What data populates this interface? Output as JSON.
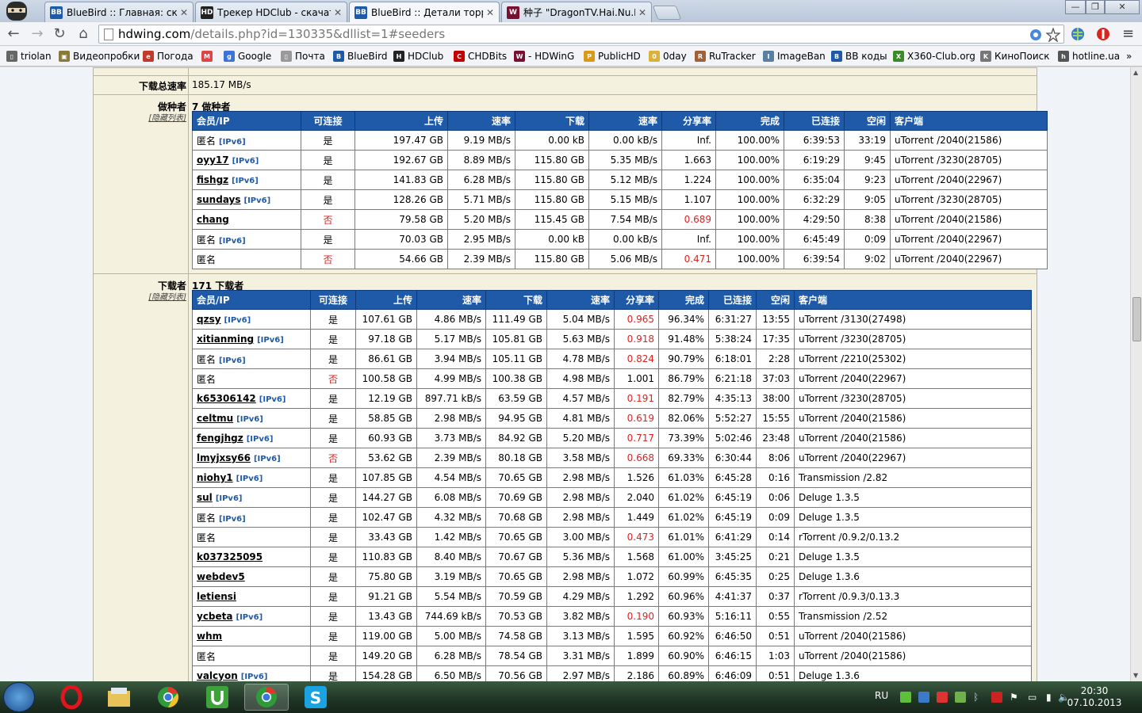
{
  "browser": {
    "tabs": [
      {
        "title": "BlueBird :: Главная: скача",
        "active": false,
        "fav": "BB",
        "color": "#1e5aa8"
      },
      {
        "title": "Трекер HDClub - скачать",
        "active": false,
        "fav": "HD",
        "color": "#222222"
      },
      {
        "title": "BlueBird :: Детали торрен",
        "active": true,
        "fav": "BB",
        "color": "#1e5aa8"
      },
      {
        "title": "种子 \"DragonTV.Hai.Nu.E(",
        "active": false,
        "fav": "W",
        "color": "#7a1030"
      }
    ],
    "url_host": "hdwing.com",
    "url_path": "/details.php?id=130335&dllist=1#seeders",
    "bookmarks": [
      {
        "label": "triolan",
        "color": "#666666",
        "glyph": "▯"
      },
      {
        "label": "Видеопробки",
        "color": "#8a7a3a",
        "glyph": "▣"
      },
      {
        "label": "Погода",
        "color": "#c0392b",
        "glyph": "e"
      },
      {
        "label": "",
        "color": "#d44",
        "glyph": "M"
      },
      {
        "label": "Google",
        "color": "#3b73d9",
        "glyph": "g"
      },
      {
        "label": "Почта",
        "color": "#999999",
        "glyph": "▯"
      },
      {
        "label": "BlueBird",
        "color": "#1e5aa8",
        "glyph": "B"
      },
      {
        "label": "HDClub",
        "color": "#222222",
        "glyph": "H"
      },
      {
        "label": "CHDBits",
        "color": "#c00000",
        "glyph": "C"
      },
      {
        "label": "- HDWinG",
        "color": "#7a1030",
        "glyph": "W"
      },
      {
        "label": "PublicHD",
        "color": "#d99a1a",
        "glyph": "P"
      },
      {
        "label": "0day",
        "color": "#d8b23a",
        "glyph": "0"
      },
      {
        "label": "RuTracker",
        "color": "#a0603a",
        "glyph": "R"
      },
      {
        "label": "ImageBan",
        "color": "#5a7fa0",
        "glyph": "I"
      },
      {
        "label": "BB коды",
        "color": "#1e5aa8",
        "glyph": "B"
      },
      {
        "label": "X360-Club.org",
        "color": "#3a8a2a",
        "glyph": "X"
      },
      {
        "label": "КиноПоиск",
        "color": "#777777",
        "glyph": "K"
      },
      {
        "label": "hotline.ua",
        "color": "#555555",
        "glyph": "h"
      }
    ],
    "more": "»"
  },
  "page": {
    "speed_label": "下载总速率",
    "speed_value": "185.17 MB/s",
    "seeders": {
      "label": "做种者",
      "toggle": "[隐藏列表]",
      "title": "7 做种者",
      "headers": [
        "会员/IP",
        "可连接",
        "上传",
        "速率",
        "下载",
        "速率",
        "分享率",
        "完成",
        "已连接",
        "空闲",
        "客户端"
      ],
      "rows": [
        {
          "user": "匿名",
          "linked": false,
          "ipv6": true,
          "conn": "是",
          "conn_red": false,
          "up": "197.47 GB",
          "up_rate": "9.19 MB/s",
          "down": "0.00 kB",
          "down_rate": "0.00 kB/s",
          "ratio": "Inf.",
          "ratio_red": false,
          "done": "100.00%",
          "connected": "6:39:53",
          "idle": "33:19",
          "client": "uTorrent /2040(21586)"
        },
        {
          "user": "oyy17",
          "linked": true,
          "ipv6": true,
          "conn": "是",
          "conn_red": false,
          "up": "192.67 GB",
          "up_rate": "8.89 MB/s",
          "down": "115.80 GB",
          "down_rate": "5.35 MB/s",
          "ratio": "1.663",
          "ratio_red": false,
          "done": "100.00%",
          "connected": "6:19:29",
          "idle": "9:45",
          "client": "uTorrent /3230(28705)"
        },
        {
          "user": "fishgz",
          "linked": true,
          "ipv6": true,
          "conn": "是",
          "conn_red": false,
          "up": "141.83 GB",
          "up_rate": "6.28 MB/s",
          "down": "115.80 GB",
          "down_rate": "5.12 MB/s",
          "ratio": "1.224",
          "ratio_red": false,
          "done": "100.00%",
          "connected": "6:35:04",
          "idle": "9:23",
          "client": "uTorrent /2040(22967)"
        },
        {
          "user": "sundays",
          "linked": true,
          "ipv6": true,
          "conn": "是",
          "conn_red": false,
          "up": "128.26 GB",
          "up_rate": "5.71 MB/s",
          "down": "115.80 GB",
          "down_rate": "5.15 MB/s",
          "ratio": "1.107",
          "ratio_red": false,
          "done": "100.00%",
          "connected": "6:32:29",
          "idle": "9:05",
          "client": "uTorrent /3230(28705)"
        },
        {
          "user": "chang",
          "linked": true,
          "ipv6": false,
          "conn": "否",
          "conn_red": true,
          "up": "79.58 GB",
          "up_rate": "5.20 MB/s",
          "down": "115.45 GB",
          "down_rate": "7.54 MB/s",
          "ratio": "0.689",
          "ratio_red": true,
          "done": "100.00%",
          "connected": "4:29:50",
          "idle": "8:38",
          "client": "uTorrent /2040(21586)"
        },
        {
          "user": "匿名",
          "linked": false,
          "ipv6": true,
          "conn": "是",
          "conn_red": false,
          "up": "70.03 GB",
          "up_rate": "2.95 MB/s",
          "down": "0.00 kB",
          "down_rate": "0.00 kB/s",
          "ratio": "Inf.",
          "ratio_red": false,
          "done": "100.00%",
          "connected": "6:45:49",
          "idle": "0:09",
          "client": "uTorrent /2040(22967)"
        },
        {
          "user": "匿名",
          "linked": false,
          "ipv6": false,
          "conn": "否",
          "conn_red": true,
          "up": "54.66 GB",
          "up_rate": "2.39 MB/s",
          "down": "115.80 GB",
          "down_rate": "5.06 MB/s",
          "ratio": "0.471",
          "ratio_red": true,
          "done": "100.00%",
          "connected": "6:39:54",
          "idle": "9:02",
          "client": "uTorrent /2040(22967)"
        }
      ]
    },
    "leechers": {
      "label": "下载者",
      "toggle": "[隐藏列表]",
      "title": "171 下载者",
      "headers": [
        "会员/IP",
        "可连接",
        "上传",
        "速率",
        "下载",
        "速率",
        "分享率",
        "完成",
        "已连接",
        "空闲",
        "客户端"
      ],
      "rows": [
        {
          "user": "qzsy",
          "linked": true,
          "ipv6": true,
          "conn": "是",
          "conn_red": false,
          "up": "107.61 GB",
          "up_rate": "4.86 MB/s",
          "down": "111.49 GB",
          "down_rate": "5.04 MB/s",
          "ratio": "0.965",
          "ratio_red": true,
          "done": "96.34%",
          "connected": "6:31:27",
          "idle": "13:55",
          "client": "uTorrent /3130(27498)"
        },
        {
          "user": "xitianming",
          "linked": true,
          "ipv6": true,
          "conn": "是",
          "conn_red": false,
          "up": "97.18 GB",
          "up_rate": "5.17 MB/s",
          "down": "105.81 GB",
          "down_rate": "5.63 MB/s",
          "ratio": "0.918",
          "ratio_red": true,
          "done": "91.48%",
          "connected": "5:38:24",
          "idle": "17:35",
          "client": "uTorrent /3230(28705)"
        },
        {
          "user": "匿名",
          "linked": false,
          "ipv6": true,
          "conn": "是",
          "conn_red": false,
          "up": "86.61 GB",
          "up_rate": "3.94 MB/s",
          "down": "105.11 GB",
          "down_rate": "4.78 MB/s",
          "ratio": "0.824",
          "ratio_red": true,
          "done": "90.79%",
          "connected": "6:18:01",
          "idle": "2:28",
          "client": "uTorrent /2210(25302)"
        },
        {
          "user": "匿名",
          "linked": false,
          "ipv6": false,
          "conn": "否",
          "conn_red": true,
          "up": "100.58 GB",
          "up_rate": "4.99 MB/s",
          "down": "100.38 GB",
          "down_rate": "4.98 MB/s",
          "ratio": "1.001",
          "ratio_red": false,
          "done": "86.79%",
          "connected": "6:21:18",
          "idle": "37:03",
          "client": "uTorrent /2040(22967)"
        },
        {
          "user": "k65306142",
          "linked": true,
          "ipv6": true,
          "conn": "是",
          "conn_red": false,
          "up": "12.19 GB",
          "up_rate": "897.71 kB/s",
          "down": "63.59 GB",
          "down_rate": "4.57 MB/s",
          "ratio": "0.191",
          "ratio_red": true,
          "done": "82.79%",
          "connected": "4:35:13",
          "idle": "38:00",
          "client": "uTorrent /3230(28705)"
        },
        {
          "user": "celtmu",
          "linked": true,
          "ipv6": true,
          "conn": "是",
          "conn_red": false,
          "up": "58.85 GB",
          "up_rate": "2.98 MB/s",
          "down": "94.95 GB",
          "down_rate": "4.81 MB/s",
          "ratio": "0.619",
          "ratio_red": true,
          "done": "82.06%",
          "connected": "5:52:27",
          "idle": "15:55",
          "client": "uTorrent /2040(21586)"
        },
        {
          "user": "fengjhgz",
          "linked": true,
          "ipv6": true,
          "conn": "是",
          "conn_red": false,
          "up": "60.93 GB",
          "up_rate": "3.73 MB/s",
          "down": "84.92 GB",
          "down_rate": "5.20 MB/s",
          "ratio": "0.717",
          "ratio_red": true,
          "done": "73.39%",
          "connected": "5:02:46",
          "idle": "23:48",
          "client": "uTorrent /2040(21586)"
        },
        {
          "user": "lmyjxsy66",
          "linked": true,
          "ipv6": true,
          "conn": "否",
          "conn_red": true,
          "up": "53.62 GB",
          "up_rate": "2.39 MB/s",
          "down": "80.18 GB",
          "down_rate": "3.58 MB/s",
          "ratio": "0.668",
          "ratio_red": true,
          "done": "69.33%",
          "connected": "6:30:44",
          "idle": "8:06",
          "client": "uTorrent /2040(22967)"
        },
        {
          "user": "niohy1",
          "linked": true,
          "ipv6": true,
          "conn": "是",
          "conn_red": false,
          "up": "107.85 GB",
          "up_rate": "4.54 MB/s",
          "down": "70.65 GB",
          "down_rate": "2.98 MB/s",
          "ratio": "1.526",
          "ratio_red": false,
          "done": "61.03%",
          "connected": "6:45:28",
          "idle": "0:16",
          "client": "Transmission /2.82"
        },
        {
          "user": "sul",
          "linked": true,
          "ipv6": true,
          "conn": "是",
          "conn_red": false,
          "up": "144.27 GB",
          "up_rate": "6.08 MB/s",
          "down": "70.69 GB",
          "down_rate": "2.98 MB/s",
          "ratio": "2.040",
          "ratio_red": false,
          "done": "61.02%",
          "connected": "6:45:19",
          "idle": "0:06",
          "client": "Deluge 1.3.5"
        },
        {
          "user": "匿名",
          "linked": false,
          "ipv6": true,
          "conn": "是",
          "conn_red": false,
          "up": "102.47 GB",
          "up_rate": "4.32 MB/s",
          "down": "70.68 GB",
          "down_rate": "2.98 MB/s",
          "ratio": "1.449",
          "ratio_red": false,
          "done": "61.02%",
          "connected": "6:45:19",
          "idle": "0:09",
          "client": "Deluge 1.3.5"
        },
        {
          "user": "匿名",
          "linked": false,
          "ipv6": false,
          "conn": "是",
          "conn_red": false,
          "up": "33.43 GB",
          "up_rate": "1.42 MB/s",
          "down": "70.65 GB",
          "down_rate": "3.00 MB/s",
          "ratio": "0.473",
          "ratio_red": true,
          "done": "61.01%",
          "connected": "6:41:29",
          "idle": "0:14",
          "client": "rTorrent /0.9.2/0.13.2"
        },
        {
          "user": "k037325095",
          "linked": true,
          "ipv6": false,
          "conn": "是",
          "conn_red": false,
          "up": "110.83 GB",
          "up_rate": "8.40 MB/s",
          "down": "70.67 GB",
          "down_rate": "5.36 MB/s",
          "ratio": "1.568",
          "ratio_red": false,
          "done": "61.00%",
          "connected": "3:45:25",
          "idle": "0:21",
          "client": "Deluge 1.3.5"
        },
        {
          "user": "webdev5",
          "linked": true,
          "ipv6": false,
          "conn": "是",
          "conn_red": false,
          "up": "75.80 GB",
          "up_rate": "3.19 MB/s",
          "down": "70.65 GB",
          "down_rate": "2.98 MB/s",
          "ratio": "1.072",
          "ratio_red": false,
          "done": "60.99%",
          "connected": "6:45:35",
          "idle": "0:25",
          "client": "Deluge 1.3.6"
        },
        {
          "user": "letiensi",
          "linked": true,
          "ipv6": false,
          "conn": "是",
          "conn_red": false,
          "up": "91.21 GB",
          "up_rate": "5.54 MB/s",
          "down": "70.59 GB",
          "down_rate": "4.29 MB/s",
          "ratio": "1.292",
          "ratio_red": false,
          "done": "60.96%",
          "connected": "4:41:37",
          "idle": "0:37",
          "client": "rTorrent /0.9.3/0.13.3"
        },
        {
          "user": "ycbeta",
          "linked": true,
          "ipv6": true,
          "conn": "是",
          "conn_red": false,
          "up": "13.43 GB",
          "up_rate": "744.69 kB/s",
          "down": "70.53 GB",
          "down_rate": "3.82 MB/s",
          "ratio": "0.190",
          "ratio_red": true,
          "done": "60.93%",
          "connected": "5:16:11",
          "idle": "0:55",
          "client": "Transmission /2.52"
        },
        {
          "user": "whm",
          "linked": true,
          "ipv6": false,
          "conn": "是",
          "conn_red": false,
          "up": "119.00 GB",
          "up_rate": "5.00 MB/s",
          "down": "74.58 GB",
          "down_rate": "3.13 MB/s",
          "ratio": "1.595",
          "ratio_red": false,
          "done": "60.92%",
          "connected": "6:46:50",
          "idle": "0:51",
          "client": "uTorrent /2040(21586)"
        },
        {
          "user": "匿名",
          "linked": false,
          "ipv6": false,
          "conn": "是",
          "conn_red": false,
          "up": "149.20 GB",
          "up_rate": "6.28 MB/s",
          "down": "78.54 GB",
          "down_rate": "3.31 MB/s",
          "ratio": "1.899",
          "ratio_red": false,
          "done": "60.90%",
          "connected": "6:46:15",
          "idle": "1:03",
          "client": "uTorrent /2040(21586)"
        },
        {
          "user": "valcyon",
          "linked": true,
          "ipv6": true,
          "conn": "是",
          "conn_red": false,
          "up": "154.28 GB",
          "up_rate": "6.50 MB/s",
          "down": "70.56 GB",
          "down_rate": "2.97 MB/s",
          "ratio": "2.186",
          "ratio_red": false,
          "done": "60.89%",
          "connected": "6:46:09",
          "idle": "0:51",
          "client": "Deluge 1.3.6"
        }
      ]
    },
    "ipv6_tag": "[IPv6]"
  },
  "taskbar": {
    "lang": "RU",
    "time": "20:30",
    "date": "07.10.2013"
  }
}
